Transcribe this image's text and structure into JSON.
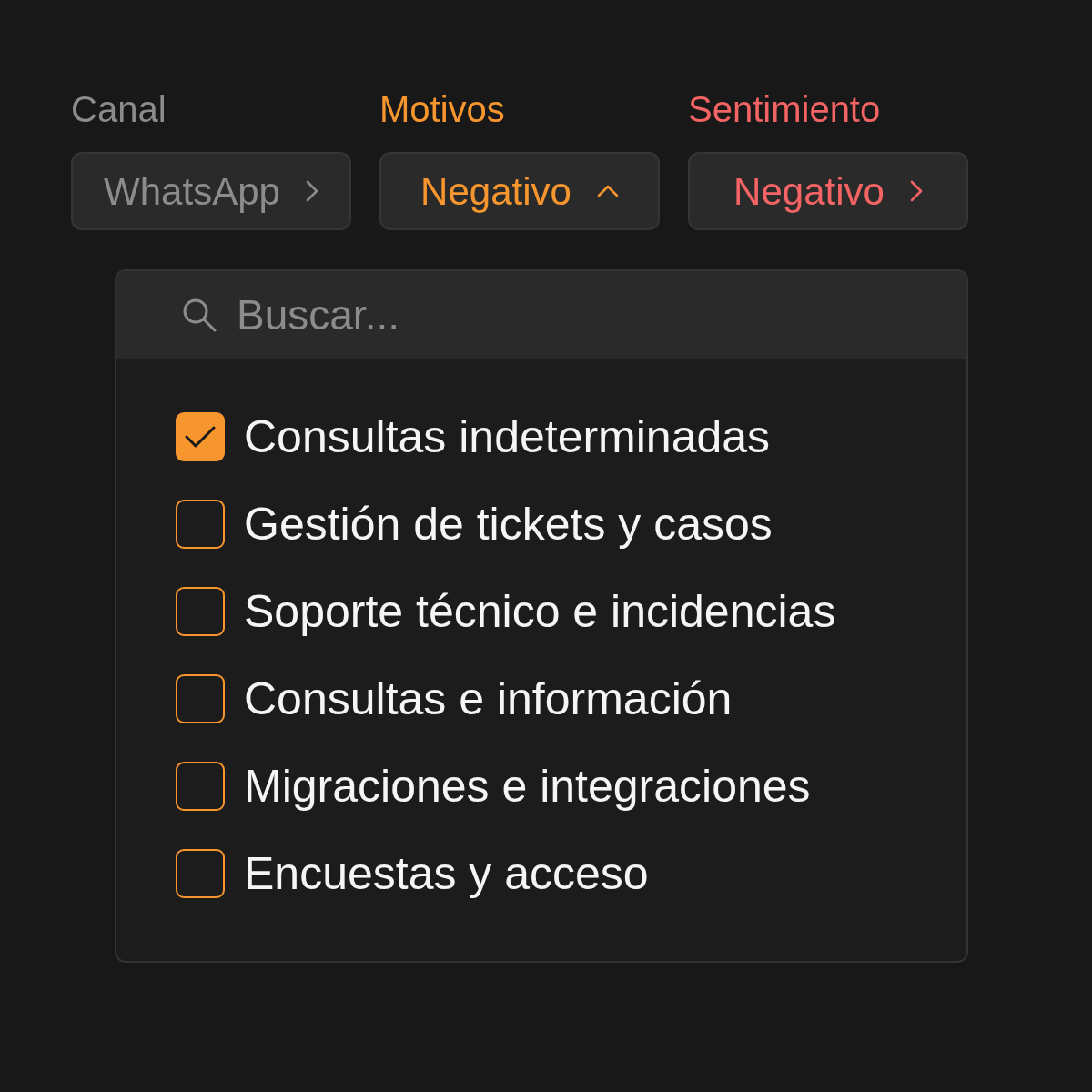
{
  "filters": [
    {
      "label": "Canal",
      "value": "WhatsApp",
      "color": "#8c8c8c",
      "expanded": false
    },
    {
      "label": "Motivos",
      "value": "Negativo",
      "color": "#f7962f",
      "expanded": true
    },
    {
      "label": "Sentimiento",
      "value": "Negativo",
      "color": "#f46464",
      "expanded": false
    }
  ],
  "dropdown": {
    "search": {
      "placeholder": "Buscar..."
    },
    "options": [
      {
        "label": "Consultas indeterminadas",
        "checked": true
      },
      {
        "label": "Gestión de tickets y casos",
        "checked": false
      },
      {
        "label": "Soporte técnico e incidencias",
        "checked": false
      },
      {
        "label": "Consultas e información",
        "checked": false
      },
      {
        "label": "Migraciones e integraciones",
        "checked": false
      },
      {
        "label": "Encuestas y acceso",
        "checked": false
      }
    ]
  }
}
